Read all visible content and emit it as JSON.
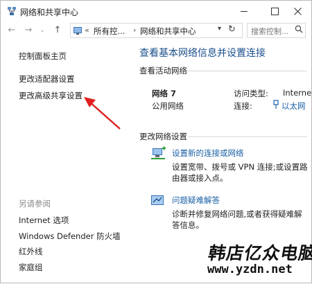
{
  "window": {
    "title": "网络和共享中心"
  },
  "address_bar": {
    "overflow_chevron": "«",
    "crumbs": [
      "所有控...",
      "网络和共享中心"
    ],
    "separator": "›",
    "search_placeholder": "搜索控制..."
  },
  "sidebar": {
    "items": [
      {
        "label": "控制面板主页"
      },
      {
        "label": "更改适配器设置"
      },
      {
        "label": "更改高级共享设置"
      }
    ],
    "see_also_title": "另请参阅",
    "see_also": [
      {
        "label": "Internet 选项"
      },
      {
        "label": "Windows Defender 防火墙"
      },
      {
        "label": "红外线"
      },
      {
        "label": "家庭组"
      }
    ]
  },
  "main": {
    "heading": "查看基本网络信息并设置连接",
    "active_title": "查看活动网络",
    "network_name": "网络  7",
    "network_type": "公用网络",
    "access_type_label": "访问类型:",
    "access_type_value": "Interne",
    "connections_label": "连接:",
    "connections_value": "以太网",
    "change_title": "更改网络设置",
    "tasks": [
      {
        "icon": "new-connection-icon",
        "title": "设置新的连接或网络",
        "desc_line1": "设置宽带、拨号或 VPN 连接;或设置路",
        "desc_line2": "由器或接入点。"
      },
      {
        "icon": "troubleshoot-icon",
        "title": "问题疑难解答",
        "desc_line1": "诊断并修复网络问题,或者获得疑难解",
        "desc_line2": "答信息。"
      }
    ]
  },
  "watermark": {
    "brand": "韩店亿众电脑",
    "url": "www.yzdn.net"
  },
  "annotation": {
    "arrow_color": "#e02020"
  }
}
